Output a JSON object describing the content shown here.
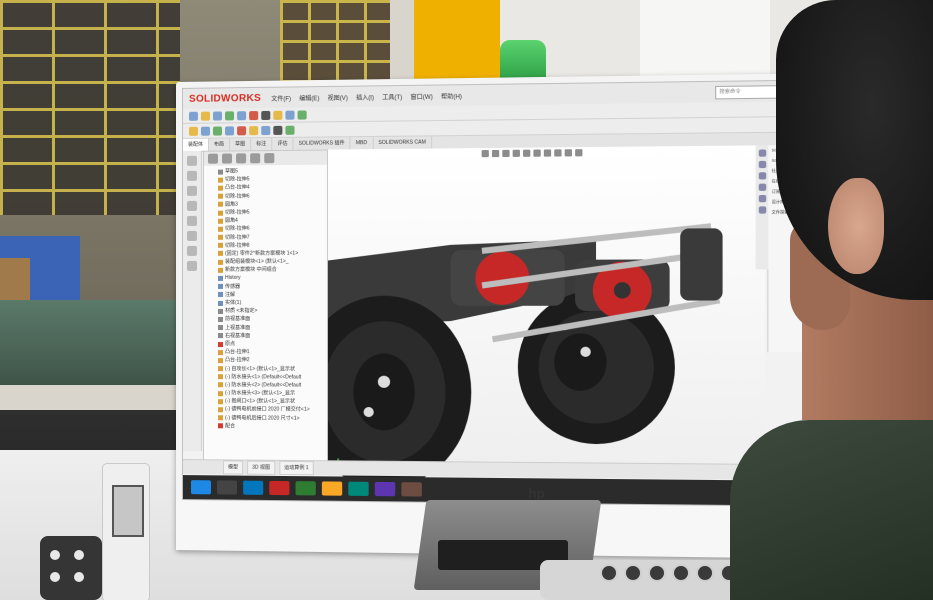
{
  "app": {
    "name": "SOLIDWORKS",
    "menus": [
      "文件(F)",
      "编辑(E)",
      "视图(V)",
      "插入(I)",
      "工具(T)",
      "窗口(W)",
      "帮助(H)"
    ],
    "search_placeholder": "搜索命令",
    "command_tabs": [
      "装配体",
      "布局",
      "草图",
      "标注",
      "评估",
      "SOLIDWORKS 插件",
      "MBD",
      "SOLIDWORKS CAM"
    ],
    "active_command_tab": "装配体",
    "tree_rows": [
      {
        "label": "草图5",
        "icon": "sketch"
      },
      {
        "label": "切除-拉伸5",
        "icon": "feature"
      },
      {
        "label": "凸台-拉伸4",
        "icon": "feature"
      },
      {
        "label": "切除-拉伸6",
        "icon": "feature"
      },
      {
        "label": "圆角3",
        "icon": "feature"
      },
      {
        "label": "切除-拉伸5",
        "icon": "feature"
      },
      {
        "label": "圆角4",
        "icon": "feature"
      },
      {
        "label": "切除-拉伸6",
        "icon": "feature"
      },
      {
        "label": "切除-拉伸7",
        "icon": "feature"
      },
      {
        "label": "切除-拉伸8",
        "icon": "feature"
      },
      {
        "label": "(固定) 零件2^新款方案模块 1<1>",
        "icon": "part"
      },
      {
        "label": "装配组装模块<1> (默认<1>_",
        "icon": "asm"
      },
      {
        "label": "新款方案模块 中间组合",
        "icon": "part"
      },
      {
        "label": "History",
        "icon": "folder"
      },
      {
        "label": "传感器",
        "icon": "folder"
      },
      {
        "label": "注解",
        "icon": "folder"
      },
      {
        "label": "实体(1)",
        "icon": "folder"
      },
      {
        "label": "材质 <未指定>",
        "icon": "material"
      },
      {
        "label": "前视基准面",
        "icon": "plane"
      },
      {
        "label": "上视基准面",
        "icon": "plane"
      },
      {
        "label": "右视基准面",
        "icon": "plane"
      },
      {
        "label": "原点",
        "icon": "origin"
      },
      {
        "label": "凸台-拉伸1",
        "icon": "feature"
      },
      {
        "label": "凸台-拉伸2",
        "icon": "feature"
      },
      {
        "label": "(-) 自攻长<1> (默认<1>_显示状",
        "icon": "part"
      },
      {
        "label": "(-) 防水接头<1> (Default<<Default",
        "icon": "part"
      },
      {
        "label": "(-) 防水接头<2> (Default<<Default",
        "icon": "part"
      },
      {
        "label": "(-) 防水接头<3> (默认<1>_显示",
        "icon": "part"
      },
      {
        "label": "(-) 抱闸口<1> (默认<1>_显示状",
        "icon": "part"
      },
      {
        "label": "(-) 德鸭电机前接口 2020 厂模交付<1>",
        "icon": "part"
      },
      {
        "label": "(-) 德鸭电机后接口 2020 尺寸<1>",
        "icon": "part"
      },
      {
        "label": "配合",
        "icon": "mate"
      }
    ],
    "task_pane_items": [
      "SOLIDWORKS 资源",
      "SOLIDWORKS 工具",
      "社区",
      "在线资源",
      "订阅服务",
      "设计库",
      "文件探索器"
    ],
    "status_tabs": [
      "模型",
      "3D 视图",
      "运动算例 1"
    ],
    "taskbar_items": [
      "start",
      "search",
      "files",
      "SOLIDWORKS",
      "browser",
      "folder",
      "chat",
      "office",
      "media"
    ]
  },
  "monitor_brand": "hp"
}
